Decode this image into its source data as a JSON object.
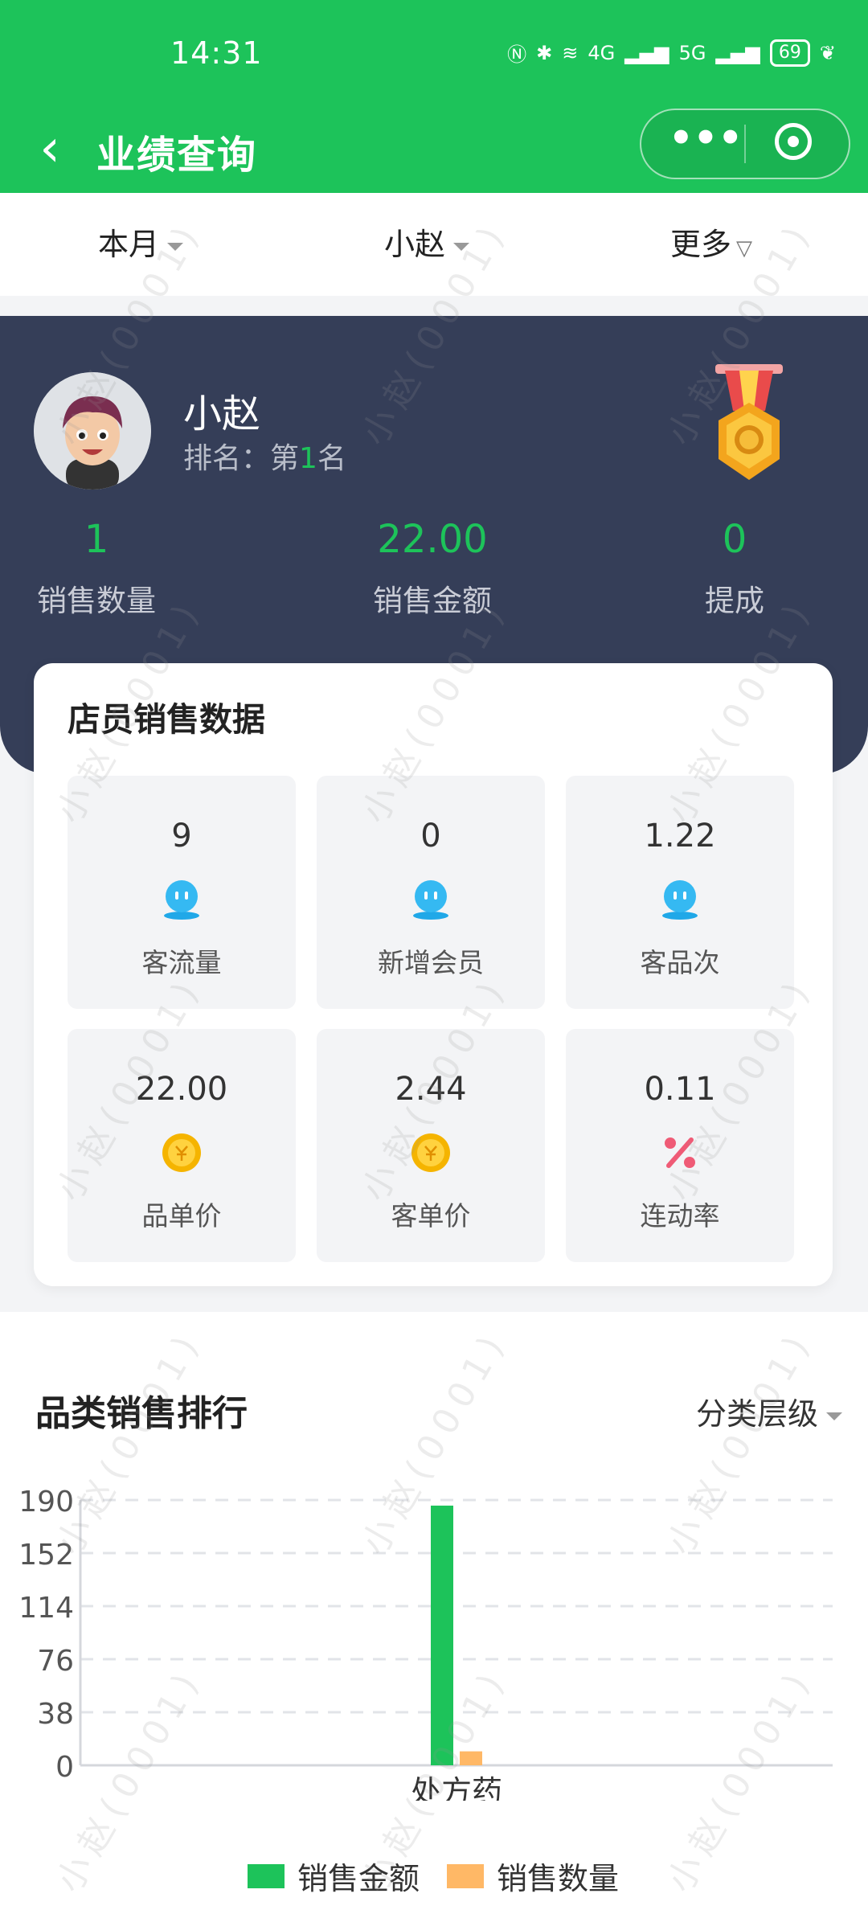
{
  "status_bar": {
    "time": "14:31",
    "battery": "69",
    "net1": "4G",
    "net2": "5G"
  },
  "navbar": {
    "title": "业绩查询"
  },
  "filters": {
    "period": "本月",
    "staff": "小赵",
    "more": "更多"
  },
  "profile": {
    "name": "小赵",
    "rank_prefix": "排名：",
    "rank_word_pre": "第",
    "rank_number": "1",
    "rank_word_post": "名"
  },
  "stats": [
    {
      "value": "1",
      "label": "销售数量"
    },
    {
      "value": "22.00",
      "label": "销售金额"
    },
    {
      "value": "0",
      "label": "提成"
    }
  ],
  "staff_card": {
    "title": "店员销售数据",
    "cells": [
      {
        "value": "9",
        "label": "客流量",
        "icon": "robot-face-icon"
      },
      {
        "value": "0",
        "label": "新增会员",
        "icon": "robot-face-icon"
      },
      {
        "value": "1.22",
        "label": "客品次",
        "icon": "robot-face-icon"
      },
      {
        "value": "22.00",
        "label": "品单价",
        "icon": "yuan-coin-icon"
      },
      {
        "value": "2.44",
        "label": "客单价",
        "icon": "yuan-coin-icon"
      },
      {
        "value": "0.11",
        "label": "连动率",
        "icon": "percent-icon"
      }
    ]
  },
  "category_section": {
    "title": "品类销售排行",
    "level_selector": "分类层级"
  },
  "watermark": "小赵(0001)",
  "colors": {
    "primary": "#1dc35a",
    "hero_bg": "#353e58",
    "bar_qty": "#ffb866"
  },
  "chart_data": {
    "type": "bar",
    "categories": [
      "处方药"
    ],
    "series": [
      {
        "name": "销售金额",
        "values": [
          186
        ],
        "color": "#1dc35a"
      },
      {
        "name": "销售数量",
        "values": [
          10
        ],
        "color": "#ffb866"
      }
    ],
    "yticks": [
      "0",
      "38",
      "76",
      "114",
      "152",
      "190"
    ],
    "ylim": [
      0,
      190
    ],
    "grid": true,
    "legend": "bottom"
  }
}
